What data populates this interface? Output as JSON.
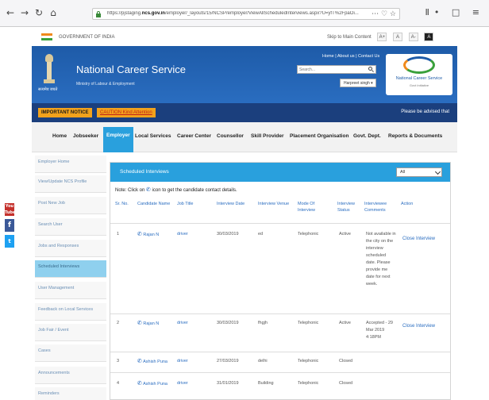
{
  "browser": {
    "back": "←",
    "forward": "→",
    "reload": "↻",
    "home": "⌂",
    "url_prefix": "https://pjstaging.",
    "url_host": "ncs.gov.in",
    "url_path": "/employer/_layouts/15/NCSP/employer/ViewAllScheduledInterviews.aspx?U=yfT%2FpaOi...",
    "url_actions": "⋯ ♡ ☆",
    "tools": "Ⅱ• □ ≡"
  },
  "gov_bar": {
    "text": "GOVERNMENT OF INDIA",
    "skip": "Skip to Main Content",
    "font_buttons": [
      "A+",
      "A",
      "A-",
      "A"
    ]
  },
  "header": {
    "title": "National Career Service",
    "subtitle": "Ministry of Labour & Employment",
    "emblem_caption": "सत्यमेव जयते",
    "top_links": "Home | About us | Contact Us",
    "search_placeholder": "Search...",
    "user": "Harpreet singh ▾",
    "logo_text": "National Career Service",
    "logo_sub": "Govt Initiative"
  },
  "notice": {
    "label": "IMPORTANT NOTICE",
    "caution": "CAUTION Kind Attention",
    "ticker": "Please be advised that"
  },
  "nav": {
    "items": [
      "Home",
      "Jobseeker",
      "Employer",
      "Local Services",
      "Career Center",
      "Counsellor",
      "Skill Provider",
      "Placement Organisation",
      "Govt. Dept.",
      "Reports & Documents"
    ]
  },
  "sidebar": {
    "items": [
      "Employer Home",
      "View/Update NCS Profile",
      "Post New Job",
      "Search User",
      "Jobs and Responses",
      "Scheduled Interviews",
      "User Management",
      "Feedback on Local Services",
      "Job Fair / Event",
      "Cases",
      "Announcements",
      "Reminders"
    ]
  },
  "social": {
    "youtube": "You Tube",
    "facebook": "f",
    "twitter": "t"
  },
  "panel": {
    "title": "Scheduled Interviews",
    "filter": "All",
    "note_prefix": "Note: Click on ",
    "note_icon": "✆",
    "note_suffix": " icon to get the candidate contact details.",
    "headers": [
      "Sr. No.",
      "Candidate Name",
      "Job Title",
      "Interview Date",
      "Interview Venue",
      "Mode Of Interview",
      "Interview Status",
      "Interviewee Comments",
      "Action"
    ],
    "rows": [
      {
        "sr": "1",
        "name": "Rajan N",
        "job": "driver",
        "date": "30/03/2019",
        "venue": "ed",
        "mode": "Telephonic",
        "status": "Active",
        "comments": "Not available in the city on the interview scheduled date. Please provide me date for next week.",
        "action": "Close Interview"
      },
      {
        "sr": "2",
        "name": "Rajan N",
        "job": "driver",
        "date": "30/03/2019",
        "venue": "fhgjh",
        "mode": "Telephonic",
        "status": "Active",
        "comments": "Accepted - 29 Mar 2019 4:18PM",
        "action": "Close Interview"
      },
      {
        "sr": "3",
        "name": "Ashish Puna",
        "job": "driver",
        "date": "27/03/2019",
        "venue": "delhi",
        "mode": "Telephonic",
        "status": "Closed",
        "comments": "",
        "action": ""
      },
      {
        "sr": "4",
        "name": "Ashish Puna",
        "job": "driver",
        "date": "31/01/2019",
        "venue": "Building",
        "mode": "Telephonic",
        "status": "Closed",
        "comments": "",
        "action": ""
      }
    ]
  },
  "colors": {
    "header_blue": "#1e5ba8",
    "accent_blue": "#29a0dd",
    "notice_orange": "#f2a21c"
  }
}
